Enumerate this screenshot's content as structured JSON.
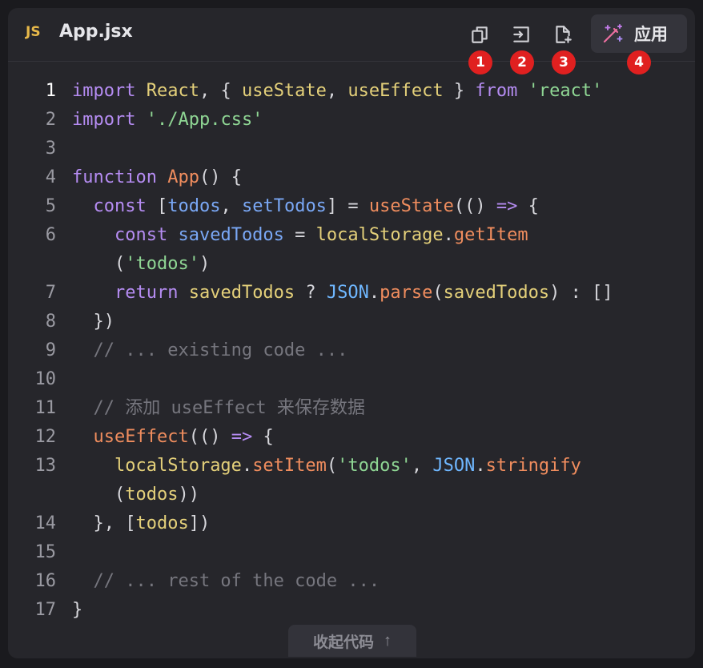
{
  "header": {
    "language_badge": "JS",
    "file_name": "App.jsx",
    "apply_label": "应用",
    "tools": [
      {
        "icon": "copy-icon",
        "badge": "1"
      },
      {
        "icon": "insert-at-cursor-icon",
        "badge": "2"
      },
      {
        "icon": "new-file-icon",
        "badge": "3"
      },
      {
        "icon": "magic-wand-icon",
        "badge": "4"
      }
    ]
  },
  "code": {
    "active_line": 1,
    "lines": [
      {
        "n": "1",
        "tokens": [
          [
            "kw",
            "import"
          ],
          [
            "pun",
            " "
          ],
          [
            "id",
            "React"
          ],
          [
            "pun",
            ", { "
          ],
          [
            "id",
            "useState"
          ],
          [
            "pun",
            ", "
          ],
          [
            "id",
            "useEffect"
          ],
          [
            "pun",
            " } "
          ],
          [
            "kw",
            "from"
          ],
          [
            "pun",
            " "
          ],
          [
            "str",
            "'react'"
          ]
        ]
      },
      {
        "n": "2",
        "tokens": [
          [
            "kw",
            "import"
          ],
          [
            "pun",
            " "
          ],
          [
            "str",
            "'./App.css'"
          ]
        ]
      },
      {
        "n": "3",
        "tokens": []
      },
      {
        "n": "4",
        "tokens": [
          [
            "kw",
            "function"
          ],
          [
            "pun",
            " "
          ],
          [
            "fn",
            "App"
          ],
          [
            "pun",
            "() {"
          ]
        ]
      },
      {
        "n": "5",
        "tokens": [
          [
            "pun",
            "  "
          ],
          [
            "kw",
            "const"
          ],
          [
            "pun",
            " ["
          ],
          [
            "var",
            "todos"
          ],
          [
            "pun",
            ", "
          ],
          [
            "var",
            "setTodos"
          ],
          [
            "pun",
            "] = "
          ],
          [
            "fn",
            "useState"
          ],
          [
            "pun",
            "(() "
          ],
          [
            "kw",
            "=>"
          ],
          [
            "pun",
            " {"
          ]
        ]
      },
      {
        "n": "6",
        "tokens": [
          [
            "pun",
            "    "
          ],
          [
            "kw",
            "const"
          ],
          [
            "pun",
            " "
          ],
          [
            "var",
            "savedTodos"
          ],
          [
            "pun",
            " = "
          ],
          [
            "id",
            "localStorage"
          ],
          [
            "pun",
            "."
          ],
          [
            "fn",
            "getItem"
          ]
        ]
      },
      {
        "n": "",
        "tokens": [
          [
            "pun",
            "    ("
          ],
          [
            "str",
            "'todos'"
          ],
          [
            "pun",
            ")"
          ]
        ]
      },
      {
        "n": "7",
        "tokens": [
          [
            "pun",
            "    "
          ],
          [
            "kw",
            "return"
          ],
          [
            "pun",
            " "
          ],
          [
            "id",
            "savedTodos"
          ],
          [
            "pun",
            " ? "
          ],
          [
            "glob",
            "JSON"
          ],
          [
            "pun",
            "."
          ],
          [
            "fn",
            "parse"
          ],
          [
            "pun",
            "("
          ],
          [
            "id",
            "savedTodos"
          ],
          [
            "pun",
            ") : []"
          ]
        ]
      },
      {
        "n": "8",
        "tokens": [
          [
            "pun",
            "  })"
          ]
        ]
      },
      {
        "n": "9",
        "tokens": [
          [
            "com",
            "  // ... existing code ..."
          ]
        ]
      },
      {
        "n": "10",
        "tokens": []
      },
      {
        "n": "11",
        "tokens": [
          [
            "com",
            "  // 添加 useEffect 来保存数据"
          ]
        ]
      },
      {
        "n": "12",
        "tokens": [
          [
            "pun",
            "  "
          ],
          [
            "fn",
            "useEffect"
          ],
          [
            "pun",
            "(() "
          ],
          [
            "kw",
            "=>"
          ],
          [
            "pun",
            " {"
          ]
        ]
      },
      {
        "n": "13",
        "tokens": [
          [
            "pun",
            "    "
          ],
          [
            "id",
            "localStorage"
          ],
          [
            "pun",
            "."
          ],
          [
            "fn",
            "setItem"
          ],
          [
            "pun",
            "("
          ],
          [
            "str",
            "'todos'"
          ],
          [
            "pun",
            ", "
          ],
          [
            "glob",
            "JSON"
          ],
          [
            "pun",
            "."
          ],
          [
            "fn",
            "stringify"
          ]
        ]
      },
      {
        "n": "",
        "tokens": [
          [
            "pun",
            "    ("
          ],
          [
            "id",
            "todos"
          ],
          [
            "pun",
            "))"
          ]
        ]
      },
      {
        "n": "14",
        "tokens": [
          [
            "pun",
            "  }, ["
          ],
          [
            "id",
            "todos"
          ],
          [
            "pun",
            "])"
          ]
        ]
      },
      {
        "n": "15",
        "tokens": []
      },
      {
        "n": "16",
        "tokens": [
          [
            "com",
            "  // ... rest of the code ..."
          ]
        ]
      },
      {
        "n": "17",
        "tokens": [
          [
            "pun",
            "}"
          ]
        ]
      }
    ]
  },
  "footer": {
    "collapse_label": "收起代码",
    "collapse_arrow": "↑"
  },
  "colors": {
    "background": "#26262b",
    "keyword": "#b58cf2",
    "function": "#f08d5e",
    "string": "#8fd694",
    "identifier": "#e4d07a",
    "variable": "#7aa8f6",
    "comment": "#76767e",
    "badge": "#e02020",
    "language_badge": "#e8b94a"
  }
}
